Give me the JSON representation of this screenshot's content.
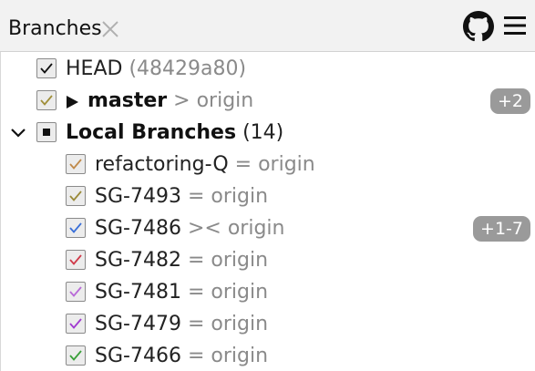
{
  "header": {
    "title": "Branches"
  },
  "icons": {
    "close": "close-icon",
    "github": "github-icon",
    "menu": "hamburger-menu-icon",
    "expand": "chevron-down-icon",
    "branch_toggle": "triangle-right-icon"
  },
  "colors": {
    "header_bg": "#f2f2f2",
    "badge_bg": "#9a9a9a",
    "text_gray": "#8a8a8a"
  },
  "tree": {
    "head": {
      "name": "HEAD",
      "hash": "(48429a80)",
      "checked": true,
      "check_color": "#111111"
    },
    "master": {
      "name": "master",
      "relation": ">",
      "remote": "origin",
      "badge": "+2",
      "checked": true,
      "check_color": "#a08f3a"
    },
    "local": {
      "title": "Local Branches",
      "count": "(14)",
      "expanded": true
    },
    "branches": [
      {
        "name": "refactoring-Q",
        "relation": "=",
        "remote": "origin",
        "check_color": "#c08a4a",
        "badge": ""
      },
      {
        "name": "SG-7493",
        "relation": "=",
        "remote": "origin",
        "check_color": "#9a8a3a",
        "badge": ""
      },
      {
        "name": "SG-7486",
        "relation": "><",
        "remote": "origin",
        "check_color": "#3a6fd8",
        "badge": "+1-7"
      },
      {
        "name": "SG-7482",
        "relation": "=",
        "remote": "origin",
        "check_color": "#d03a4a",
        "badge": ""
      },
      {
        "name": "SG-7481",
        "relation": "=",
        "remote": "origin",
        "check_color": "#b86ad8",
        "badge": ""
      },
      {
        "name": "SG-7479",
        "relation": "=",
        "remote": "origin",
        "check_color": "#a03ad0",
        "badge": ""
      },
      {
        "name": "SG-7466",
        "relation": "=",
        "remote": "origin",
        "check_color": "#3aa03a",
        "badge": ""
      }
    ]
  }
}
